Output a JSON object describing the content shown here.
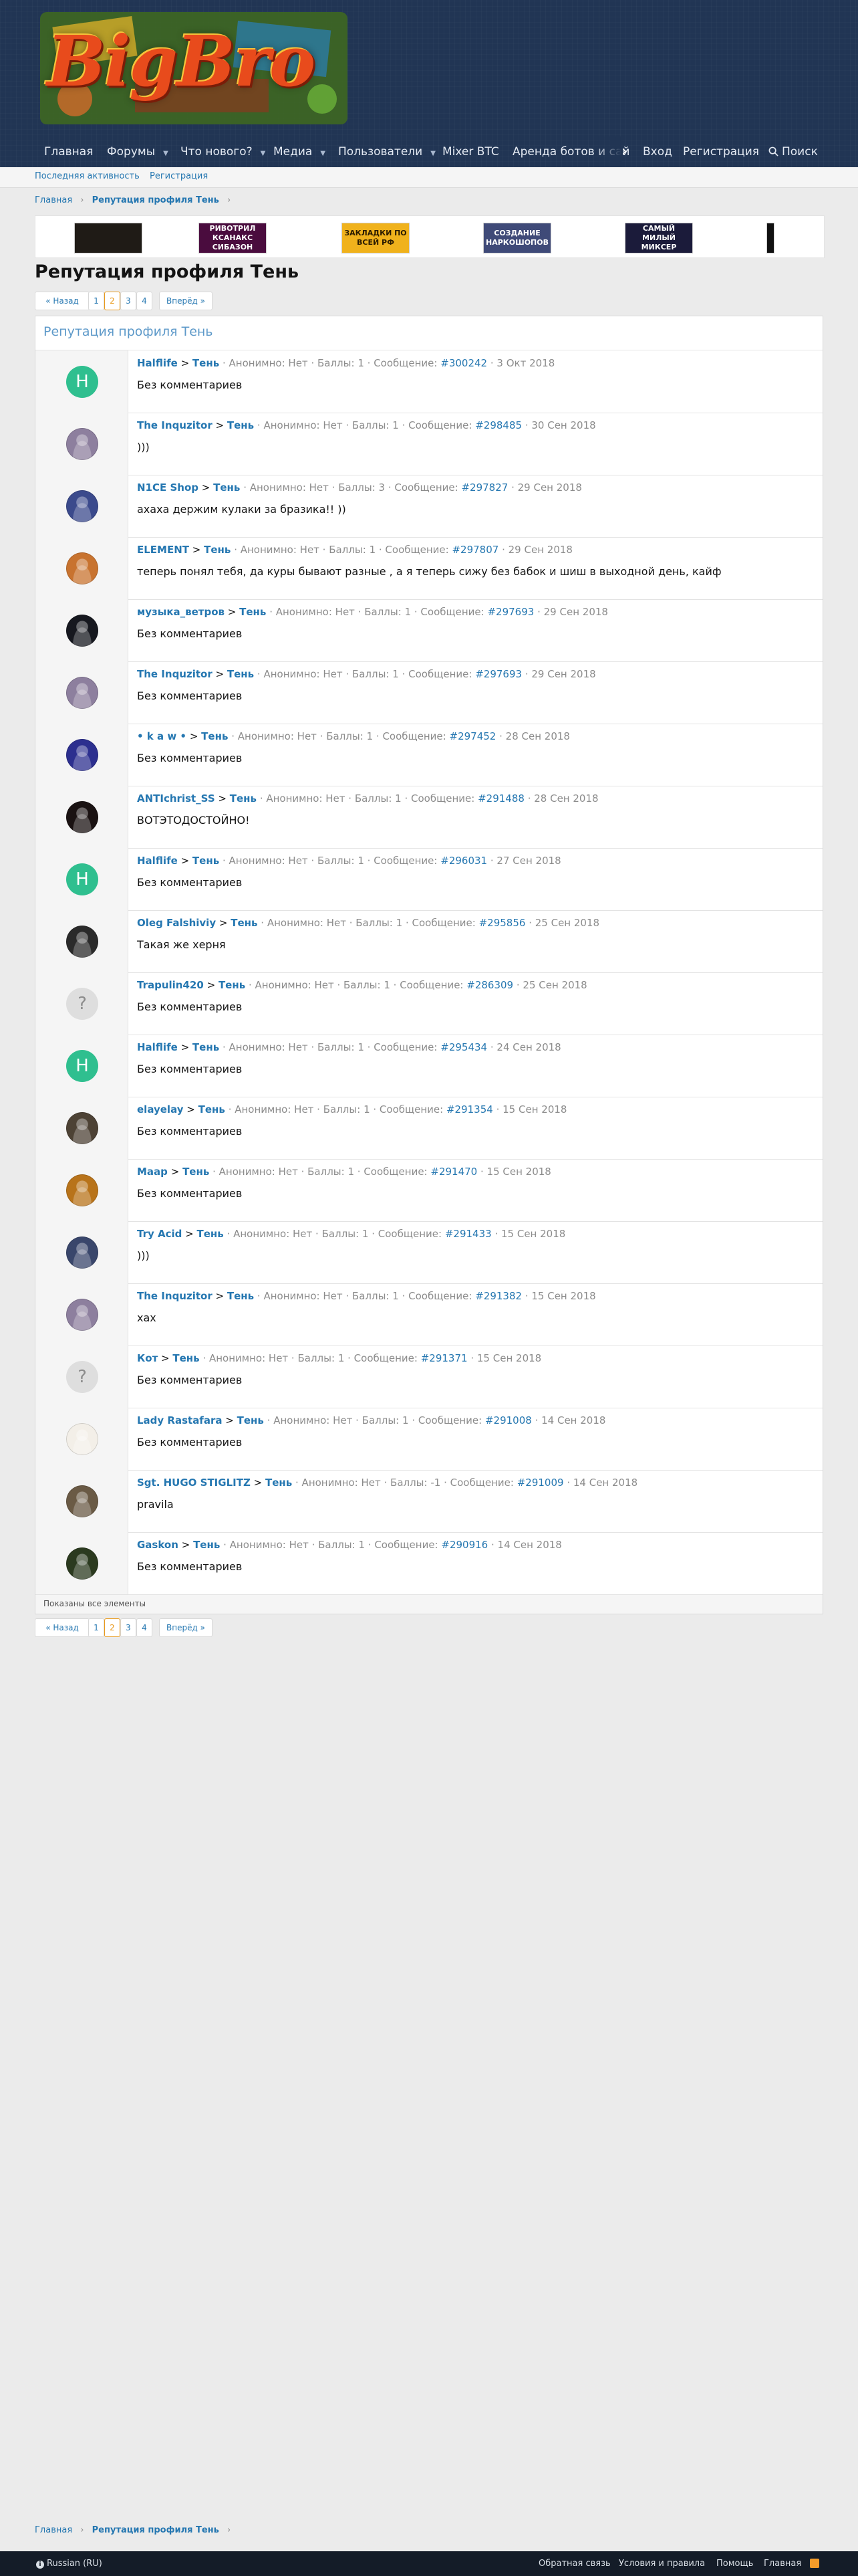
{
  "nav": {
    "items": [
      "Главная",
      "Форумы",
      "Что нового?",
      "Медиа",
      "Пользователи",
      "Mixer BTC",
      "Аренда ботов и сай"
    ],
    "login": "Вход",
    "register": "Регистрация",
    "search": "Поиск"
  },
  "subnav": {
    "recent": "Последняя активность",
    "register": "Регистрация"
  },
  "breadcrumb": {
    "home": "Главная",
    "current": "Репутация профиля Тень",
    "arrow": "›"
  },
  "banners": [
    {
      "text": "",
      "bg": "#1f1b16",
      "color": "#ffffff"
    },
    {
      "text": "РИВОТРИЛ КСАНАКС СИБАЗОН",
      "bg": "#4a0c3e",
      "color": "#ffffff"
    },
    {
      "text": "ЗАКЛАДКИ ПО ВСЕЙ РФ",
      "bg": "#f0b21c",
      "color": "#2a1b00"
    },
    {
      "text": "СОЗДАНИЕ НАРКОШОПОВ",
      "bg": "#3f4a78",
      "color": "#ffffff"
    },
    {
      "text": "САМЫЙ МИЛЫЙ МИКСЕР",
      "bg": "#1b1b3a",
      "color": "#ffffff"
    }
  ],
  "page_title": "Репутация профиля Тень",
  "pager": {
    "prev": "« Назад",
    "pages": [
      "1",
      "2",
      "3",
      "4"
    ],
    "current": "2",
    "next": "Вперёд »"
  },
  "block": {
    "title": "Репутация профиля Тень",
    "footer": "Показаны все элементы"
  },
  "labels": {
    "gt": ">",
    "target": "Тень",
    "anon": "· Анонимно: Нет · Баллы:",
    "message": "· Сообщение:"
  },
  "entries": [
    {
      "user": "Halflife",
      "points": "1",
      "post": "#300242",
      "date": "3 Окт 2018",
      "text": "Без комментариев",
      "avatar": {
        "kind": "letter",
        "letter": "H",
        "bg": "#2fbf8f"
      }
    },
    {
      "user": "The Inquzitor",
      "points": "1",
      "post": "#298485",
      "date": "30 Сен 2018",
      "text": ")))",
      "avatar": {
        "kind": "img",
        "letter": "",
        "bg": "#8d7f9e"
      }
    },
    {
      "user": "N1CE Shop",
      "points": "3",
      "post": "#297827",
      "date": "29 Сен 2018",
      "text": "ахаха держим кулаки за бразика!! ))",
      "avatar": {
        "kind": "img",
        "letter": "",
        "bg": "#3b4a8c"
      }
    },
    {
      "user": "ELEMENT",
      "points": "1",
      "post": "#297807",
      "date": "29 Сен 2018",
      "text": "теперь понял тебя, да куры бывают разные , а я теперь сижу без бабок и шиш в выходной день, кайф",
      "avatar": {
        "kind": "img",
        "letter": "",
        "bg": "#c8732f"
      }
    },
    {
      "user": "музыка_ветров",
      "points": "1",
      "post": "#297693",
      "date": "29 Сен 2018",
      "text": "Без комментариев",
      "avatar": {
        "kind": "img",
        "letter": "",
        "bg": "#16181f"
      }
    },
    {
      "user": "The Inquzitor",
      "points": "1",
      "post": "#297693",
      "date": "29 Сен 2018",
      "text": "Без комментариев",
      "avatar": {
        "kind": "img",
        "letter": "",
        "bg": "#8d7f9e"
      }
    },
    {
      "user": "• k a w •",
      "points": "1",
      "post": "#297452",
      "date": "28 Сен 2018",
      "text": "Без комментариев",
      "avatar": {
        "kind": "img",
        "letter": "",
        "bg": "#2c2f8f"
      }
    },
    {
      "user": "ANTIchrist_SS",
      "points": "1",
      "post": "#291488",
      "date": "28 Сен 2018",
      "text": "ВОТЭТОДОСТОЙНО!",
      "avatar": {
        "kind": "img",
        "letter": "",
        "bg": "#1a1212"
      }
    },
    {
      "user": "Halflife",
      "points": "1",
      "post": "#296031",
      "date": "27 Сен 2018",
      "text": "Без комментариев",
      "avatar": {
        "kind": "letter",
        "letter": "H",
        "bg": "#2fbf8f"
      }
    },
    {
      "user": "Oleg Falshiviy",
      "points": "1",
      "post": "#295856",
      "date": "25 Сен 2018",
      "text": "Такая же херня",
      "avatar": {
        "kind": "img",
        "letter": "",
        "bg": "#2a2a2a"
      }
    },
    {
      "user": "Trapulin420",
      "points": "1",
      "post": "#286309",
      "date": "25 Сен 2018",
      "text": "Без комментариев",
      "avatar": {
        "kind": "letter",
        "letter": "?",
        "bg": "#dedede"
      }
    },
    {
      "user": "Halflife",
      "points": "1",
      "post": "#295434",
      "date": "24 Сен 2018",
      "text": "Без комментариев",
      "avatar": {
        "kind": "letter",
        "letter": "H",
        "bg": "#2fbf8f"
      }
    },
    {
      "user": "elayelay",
      "points": "1",
      "post": "#291354",
      "date": "15 Сен 2018",
      "text": "Без комментариев",
      "avatar": {
        "kind": "img",
        "letter": "",
        "bg": "#4d4235"
      }
    },
    {
      "user": "Маар",
      "points": "1",
      "post": "#291470",
      "date": "15 Сен 2018",
      "text": "Без комментариев",
      "avatar": {
        "kind": "img",
        "letter": "",
        "bg": "#b8731a"
      }
    },
    {
      "user": "Try Acid",
      "points": "1",
      "post": "#291433",
      "date": "15 Сен 2018",
      "text": ")))",
      "avatar": {
        "kind": "img",
        "letter": "",
        "bg": "#39466b"
      }
    },
    {
      "user": "The Inquzitor",
      "points": "1",
      "post": "#291382",
      "date": "15 Сен 2018",
      "text": "хах",
      "avatar": {
        "kind": "img",
        "letter": "",
        "bg": "#8d7f9e"
      }
    },
    {
      "user": "Кот",
      "points": "1",
      "post": "#291371",
      "date": "15 Сен 2018",
      "text": "Без комментариев",
      "avatar": {
        "kind": "letter",
        "letter": "?",
        "bg": "#dedede"
      }
    },
    {
      "user": "Lady Rastafara",
      "points": "1",
      "post": "#291008",
      "date": "14 Сен 2018",
      "text": "Без комментариев",
      "avatar": {
        "kind": "img",
        "letter": "",
        "bg": "#f3efe8"
      }
    },
    {
      "user": "Sgt. HUGO STIGLITZ",
      "points": "-1",
      "post": "#291009",
      "date": "14 Сен 2018",
      "text": "pravila",
      "avatar": {
        "kind": "img",
        "letter": "",
        "bg": "#6a5a45"
      }
    },
    {
      "user": "Gaskon",
      "points": "1",
      "post": "#290916",
      "date": "14 Сен 2018",
      "text": "Без комментариев",
      "avatar": {
        "kind": "img",
        "letter": "",
        "bg": "#2b3a1f"
      }
    }
  ],
  "footer": {
    "language": "Russian (RU)",
    "links": [
      "Обратная связь",
      "Условия и правила",
      "Помощь",
      "Главная"
    ]
  }
}
